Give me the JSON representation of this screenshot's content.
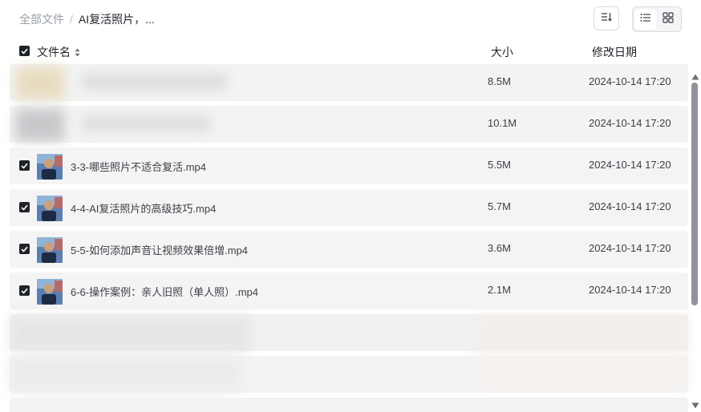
{
  "breadcrumb": {
    "root": "全部文件",
    "separator": "/",
    "current": "AI复活照片，..."
  },
  "toolbar": {
    "sort_icon": "sort-icon",
    "list_view_icon": "list-view-icon",
    "grid_view_icon": "grid-view-icon",
    "active_view": "list"
  },
  "table": {
    "columns": {
      "name": "文件名",
      "size": "大小",
      "modified": "修改日期"
    },
    "rows": [
      {
        "name": "",
        "size": "8.5M",
        "modified": "2024-10-14 17:20",
        "checked": false,
        "obscured": true
      },
      {
        "name": "",
        "size": "10.1M",
        "modified": "2024-10-14 17:20",
        "checked": false,
        "obscured": true
      },
      {
        "name": "3-3-哪些照片不适合复活.mp4",
        "size": "5.5M",
        "modified": "2024-10-14 17:20",
        "checked": true,
        "obscured": false
      },
      {
        "name": "4-4-AI复活照片的高级技巧.mp4",
        "size": "5.7M",
        "modified": "2024-10-14 17:20",
        "checked": true,
        "obscured": false
      },
      {
        "name": "5-5-如何添加声音让视频效果倍增.mp4",
        "size": "3.6M",
        "modified": "2024-10-14 17:20",
        "checked": true,
        "obscured": false
      },
      {
        "name": "6-6-操作案例：亲人旧照（单人照）.mp4",
        "size": "2.1M",
        "modified": "2024-10-14 17:20",
        "checked": true,
        "obscured": false
      }
    ]
  },
  "colors": {
    "row_bg": "#f4f4f5",
    "checkbox": "#1f2329",
    "scrollbar": "#909399"
  }
}
